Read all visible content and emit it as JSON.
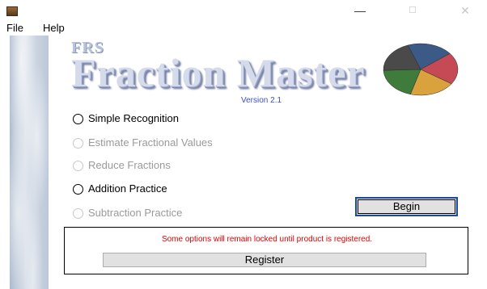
{
  "window": {
    "minimize_glyph": "—",
    "maximize_glyph": "☐",
    "close_glyph": "✕"
  },
  "menu": {
    "items": [
      "File",
      "Help"
    ]
  },
  "header": {
    "logo_small": "FRS",
    "logo_main": "Fraction Master",
    "version": "Version 2.1",
    "pie_colors": [
      "#3b5b86",
      "#c64a55",
      "#d9a23c",
      "#3f7b3a",
      "#4a4a4a"
    ]
  },
  "options": [
    {
      "label": "Simple Recognition",
      "enabled": true
    },
    {
      "label": "Estimate Fractional Values",
      "enabled": false
    },
    {
      "label": "Reduce Fractions",
      "enabled": false
    },
    {
      "label": "Addition Practice",
      "enabled": true
    },
    {
      "label": "Subtraction Practice",
      "enabled": false
    }
  ],
  "begin_label": "Begin",
  "notice": {
    "message": "Some options will remain locked until product is registered.",
    "register_label": "Register"
  }
}
